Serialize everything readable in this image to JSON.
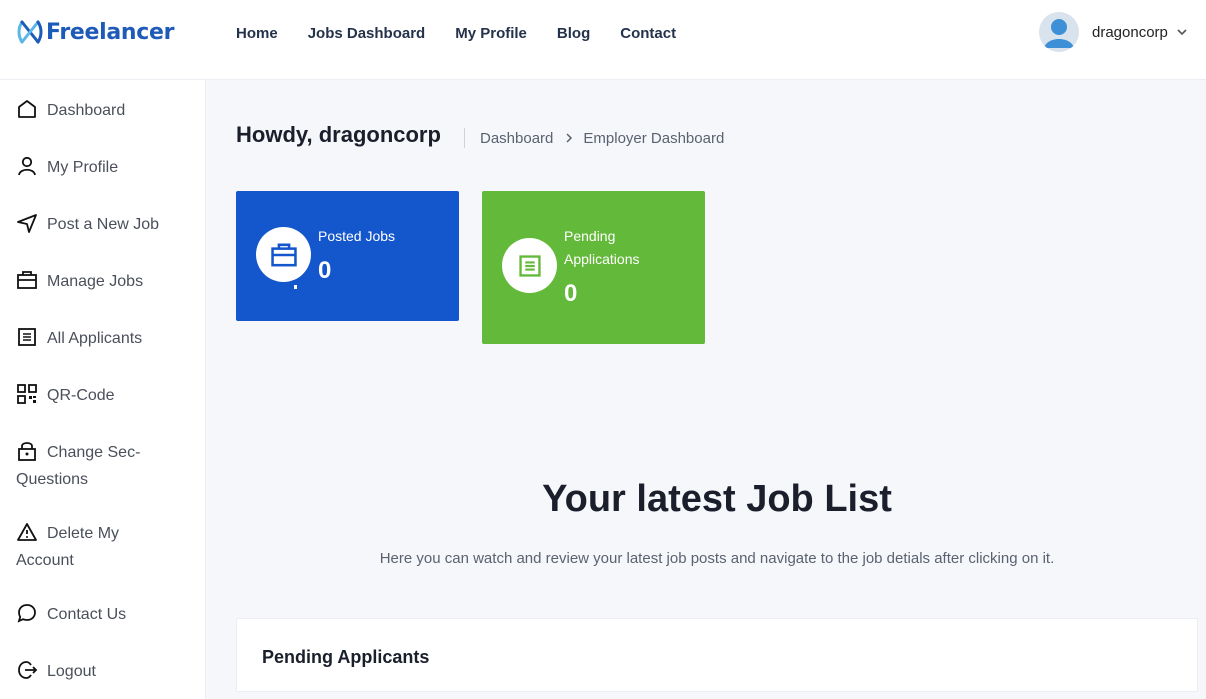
{
  "brand": {
    "name": "Freelancer",
    "color": "#1e5bb8"
  },
  "nav": {
    "items": [
      "Home",
      "Jobs Dashboard",
      "My Profile",
      "Blog",
      "Contact"
    ]
  },
  "user": {
    "name": "dragoncorp"
  },
  "sidebar": {
    "items": [
      {
        "label": "Dashboard",
        "icon": "home-icon"
      },
      {
        "label": "My Profile",
        "icon": "user-icon"
      },
      {
        "label": "Post a New Job",
        "icon": "send-icon"
      },
      {
        "label": "Manage Jobs",
        "icon": "briefcase-icon"
      },
      {
        "label": "All Applicants",
        "icon": "document-icon"
      },
      {
        "label": "QR-Code",
        "icon": "qr-code-icon"
      },
      {
        "label": "Change Sec-Questions",
        "icon": "lock-icon"
      },
      {
        "label": "Delete My Account",
        "icon": "warning-icon"
      },
      {
        "label": "Contact Us",
        "icon": "chat-icon"
      },
      {
        "label": "Logout",
        "icon": "logout-icon"
      }
    ]
  },
  "page": {
    "greeting": "Howdy, dragoncorp",
    "breadcrumb": [
      "Dashboard",
      "Employer Dashboard"
    ]
  },
  "stats": {
    "posted": {
      "label": "Posted Jobs",
      "value": "0",
      "color": "#1456cc",
      "icon": "briefcase-icon"
    },
    "pending": {
      "label": "Pending Applications",
      "value": "0",
      "color": "#63b93a",
      "icon": "document-icon"
    }
  },
  "jobs_section": {
    "title": "Your latest Job List",
    "subtitle": "Here you can watch and review your latest job posts and navigate to the job detials after clicking on it."
  },
  "panel": {
    "title": "Pending Applicants"
  }
}
